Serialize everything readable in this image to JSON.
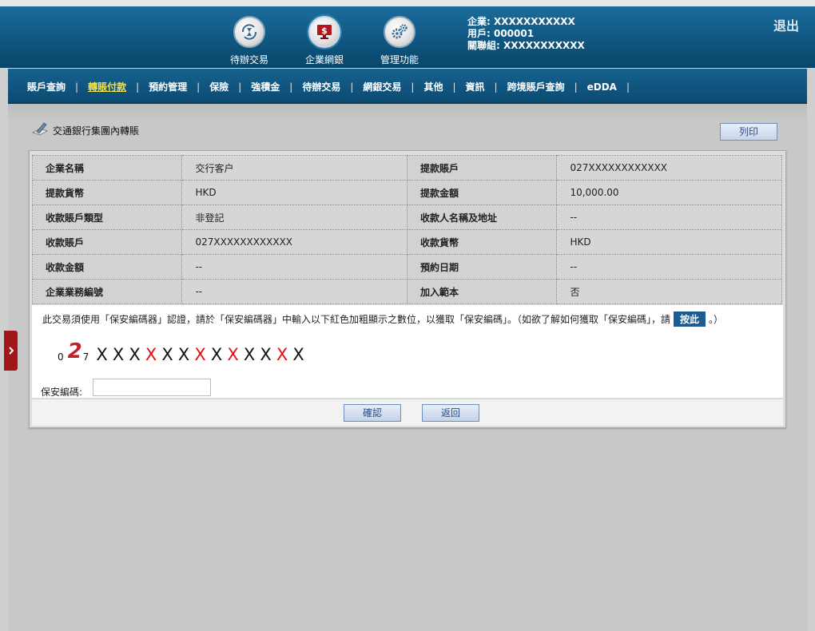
{
  "header": {
    "nav_icons": [
      {
        "label": "待辦交易",
        "icon": "hourglass-refresh-icon"
      },
      {
        "label": "企業網銀",
        "icon": "monitor-dollar-icon"
      },
      {
        "label": "管理功能",
        "icon": "gears-icon"
      }
    ],
    "user": {
      "enterprise": "企業: XXXXXXXXXXX",
      "user_id": "用戶: 000001",
      "linked_group": "關聯組: XXXXXXXXXXX"
    },
    "logout_label": "退出"
  },
  "menu": {
    "items": [
      "賬戶查詢",
      "轉賬付款",
      "預約管理",
      "保險",
      "強積金",
      "待辦交易",
      "網銀交易",
      "其他",
      "資訊",
      "跨境賬戶查詢",
      "eDDA"
    ],
    "active": "轉賬付款",
    "separator": "|"
  },
  "page": {
    "title": "交通銀行集團內轉賬",
    "print_label": "列印"
  },
  "details": [
    {
      "l1": "企業名稱",
      "v1": "交行客户",
      "l2": "提款賬戶",
      "v2": "027XXXXXXXXXXXX"
    },
    {
      "l1": "提款貨幣",
      "v1": "HKD",
      "l2": "提款金額",
      "v2": "10,000.00"
    },
    {
      "l1": "收款賬戶類型",
      "v1": "非登記",
      "l2": "收款人名稱及地址",
      "v2": "--"
    },
    {
      "l1": "收款賬戶",
      "v1": "027XXXXXXXXXXXX",
      "l2": "收款貨幣",
      "v2": "HKD"
    },
    {
      "l1": "收款金額",
      "v1": "--",
      "l2": "預約日期",
      "v2": "--"
    },
    {
      "l1": "企業業務編號",
      "v1": "--",
      "l2": "加入範本",
      "v2": "否"
    }
  ],
  "security": {
    "instruction_before": "此交易須使用「保安編碼器」認證，請於「保安編碼器」中輸入以下紅色加粗顯示之數位，以獲取「保安編碼」。（如欲了解如何獲取「保安編碼」，請",
    "here_label": "按此",
    "instruction_after": "。）",
    "code_prefix_0": "0",
    "code_prefix_2": "2",
    "code_prefix_7": "7",
    "code_chars": [
      "X",
      "X",
      "X",
      "X",
      "X",
      "X",
      "X",
      "X",
      "X",
      "X",
      "X",
      "X",
      "X"
    ],
    "code_red_flags": [
      0,
      0,
      0,
      1,
      0,
      0,
      1,
      0,
      1,
      0,
      0,
      1,
      0
    ],
    "code_label": "保安編碼:",
    "code_value": ""
  },
  "buttons": {
    "confirm": "確認",
    "back": "返回"
  },
  "colors": {
    "header_blue": "#105a86",
    "menu_active": "#f2e14a",
    "code_red": "#e01010",
    "side_tab": "#a3161b"
  }
}
